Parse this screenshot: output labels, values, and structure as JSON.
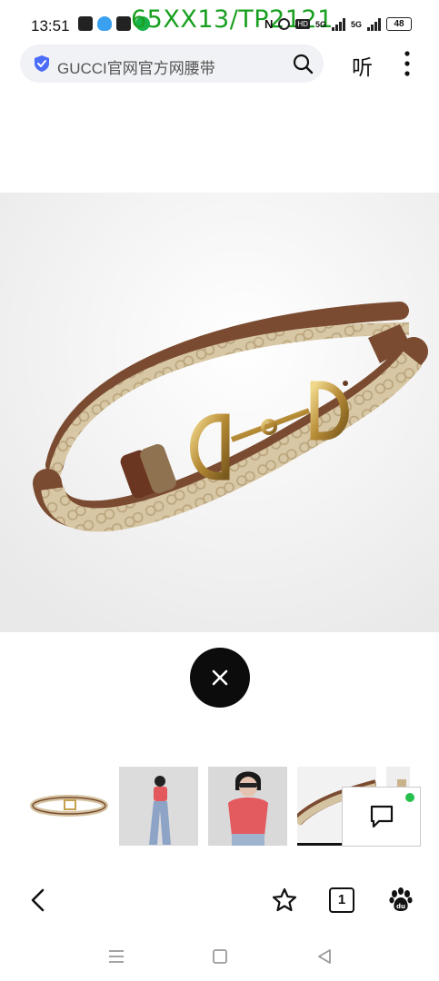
{
  "status_bar": {
    "time": "13:51",
    "watermark": "65XX13/TP2121",
    "network_1": "5G",
    "network_2": "5G",
    "battery": "48"
  },
  "search": {
    "query": "GUCCI官网官方网腰带",
    "listen_label": "听"
  },
  "toolbar": {
    "tabs_count": "1"
  },
  "icons": {
    "shield": "shield-check-icon",
    "search": "search-icon",
    "more": "more-vertical-icon",
    "close": "close-icon",
    "back": "chevron-left-icon",
    "favorite": "star-icon",
    "home": "paw-icon",
    "feedback": "chat-icon"
  },
  "colors": {
    "accent_blue": "#4a6cf7",
    "watermark_green": "#19a020",
    "status_dot": "#27c04c",
    "close_bg": "#0c0c0c"
  }
}
